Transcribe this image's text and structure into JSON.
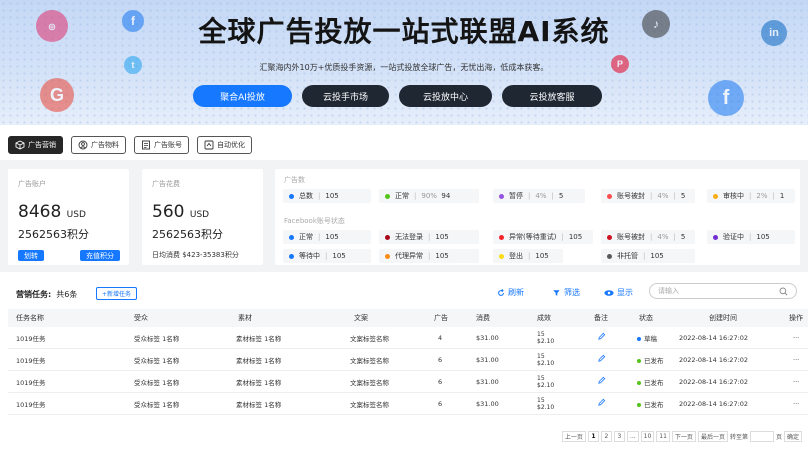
{
  "hero": {
    "title": "全球广告投放一站式联盟AI系统",
    "subtitle": "汇聚海内外10万+优质投手资源，一站式投放全球广告，无忧出海，低成本获客。",
    "buttons": [
      "聚合AI投放",
      "云投手市场",
      "云投放中心",
      "云投放客服"
    ]
  },
  "tabs": [
    "广告营销",
    "广告物料",
    "广告账号",
    "自动优化"
  ],
  "account": {
    "label": "广告账户",
    "amount": "8468",
    "unit": "USD",
    "points": "2562563积分",
    "btn_transfer": "划转",
    "btn_recharge": "充值积分"
  },
  "spend": {
    "label": "广告花费",
    "amount": "560",
    "unit": "USD",
    "points": "2562563积分",
    "daily": "日均消费  $423-35383积分"
  },
  "ads": {
    "label": "广告数",
    "items": [
      {
        "name": "总数",
        "pct": "",
        "val": "105",
        "color": "#1677ff"
      },
      {
        "name": "正常",
        "pct": "90%",
        "val": "94",
        "color": "#52c41a"
      },
      {
        "name": "暂停",
        "pct": "4%",
        "val": "5",
        "color": "#9254de"
      },
      {
        "name": "账号被封",
        "pct": "4%",
        "val": "5",
        "color": "#ff4d4f"
      },
      {
        "name": "审核中",
        "pct": "2%",
        "val": "1",
        "color": "#faad14"
      }
    ]
  },
  "fb": {
    "label": "Facebook账号状态",
    "row1": [
      {
        "name": "正常",
        "val": "105",
        "color": "#1677ff"
      },
      {
        "name": "无法登录",
        "val": "105",
        "color": "#a8071a"
      },
      {
        "name": "异常(等待重试)",
        "val": "105",
        "color": "#f5222d"
      },
      {
        "name": "账号被封",
        "pct": "4%",
        "val": "5",
        "color": "#cf1322"
      },
      {
        "name": "验证中",
        "val": "105",
        "color": "#722ed1"
      }
    ],
    "row2": [
      {
        "name": "等待中",
        "val": "105",
        "color": "#1677ff"
      },
      {
        "name": "代理异常",
        "val": "105",
        "color": "#fa8c16"
      },
      {
        "name": "登出",
        "val": "105",
        "color": "#fadb14"
      },
      {
        "name": "非托管",
        "val": "105",
        "color": "#595959"
      }
    ]
  },
  "task": {
    "title": "营销任务:",
    "count": "共6条",
    "add": "+新增任务",
    "refresh": "刷新",
    "filter": "筛选",
    "show": "显示",
    "search_placeholder": "请输入"
  },
  "table": {
    "headers": [
      "任务名称",
      "受众",
      "素材",
      "文案",
      "广告",
      "消费",
      "成效",
      "备注",
      "状态",
      "创建时间",
      "操作"
    ],
    "rows": [
      {
        "name": "1019任务",
        "aud": "受众标签 1名称",
        "mat": "素材标签 1名称",
        "copy": "文案标签名称",
        "ads": "4",
        "spend": "$31.00",
        "eff1": "15",
        "eff2": "$2.10",
        "status": "草稿",
        "status_color": "#1677ff",
        "time": "2022-08-14  16:27:02",
        "op": "···"
      },
      {
        "name": "1019任务",
        "aud": "受众标签 1名称",
        "mat": "素材标签 1名称",
        "copy": "文案标签名称",
        "ads": "6",
        "spend": "$31.00",
        "eff1": "15",
        "eff2": "$2.10",
        "status": "已发布",
        "status_color": "#52c41a",
        "time": "2022-08-14  16:27:02",
        "op": "···"
      },
      {
        "name": "1019任务",
        "aud": "受众标签 1名称",
        "mat": "素材标签 1名称",
        "copy": "文案标签名称",
        "ads": "6",
        "spend": "$31.00",
        "eff1": "15",
        "eff2": "$2.10",
        "status": "已发布",
        "status_color": "#52c41a",
        "time": "2022-08-14  16:27:02",
        "op": "···"
      },
      {
        "name": "1019任务",
        "aud": "受众标签 1名称",
        "mat": "素材标签 1名称",
        "copy": "文案标签名称",
        "ads": "6",
        "spend": "$31.00",
        "eff1": "15",
        "eff2": "$2.10",
        "status": "已发布",
        "status_color": "#52c41a",
        "time": "2022-08-14  16:27:02",
        "op": "···"
      }
    ]
  },
  "pager": {
    "prev": "上一页",
    "pages": [
      "1",
      "2",
      "3",
      "...",
      "10",
      "11"
    ],
    "next": "下一页",
    "last": "最后一页",
    "goto": "转至第",
    "page_unit": "页",
    "confirm": "确定"
  }
}
